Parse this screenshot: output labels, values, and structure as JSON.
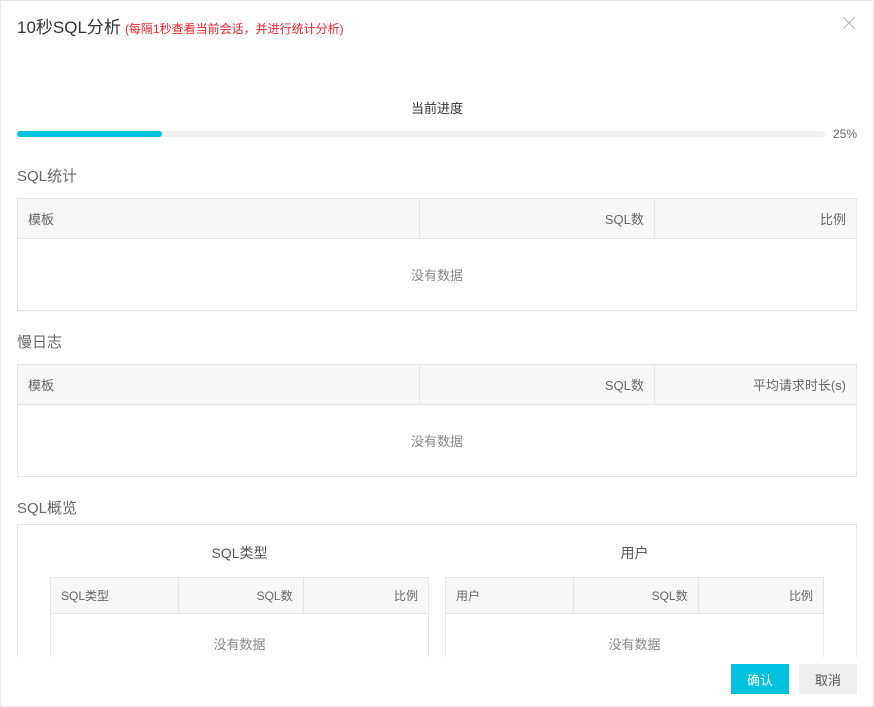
{
  "header": {
    "title": "10秒SQL分析",
    "subtitle": "(每隔1秒查看当前会话，并进行统计分析)"
  },
  "progress": {
    "label": "当前进度",
    "percent_text": "25%",
    "percent_value": 25,
    "fill_width": "18%"
  },
  "sections": {
    "sql_stats": {
      "title": "SQL统计",
      "columns": {
        "col1": "模板",
        "col2": "SQL数",
        "col3": "比例"
      },
      "empty": "没有数据"
    },
    "slow_log": {
      "title": "慢日志",
      "columns": {
        "col1": "模板",
        "col2": "SQL数",
        "col3": "平均请求时长(s)"
      },
      "empty": "没有数据"
    },
    "overview": {
      "title": "SQL概览",
      "sql_type": {
        "title": "SQL类型",
        "columns": {
          "col1": "SQL类型",
          "col2": "SQL数",
          "col3": "比例"
        },
        "empty": "没有数据"
      },
      "user": {
        "title": "用户",
        "columns": {
          "col1": "用户",
          "col2": "SQL数",
          "col3": "比例"
        },
        "empty": "没有数据"
      }
    }
  },
  "footer": {
    "confirm": "确认",
    "cancel": "取消"
  },
  "colors": {
    "accent": "#00c1de",
    "danger": "#f5222d"
  }
}
